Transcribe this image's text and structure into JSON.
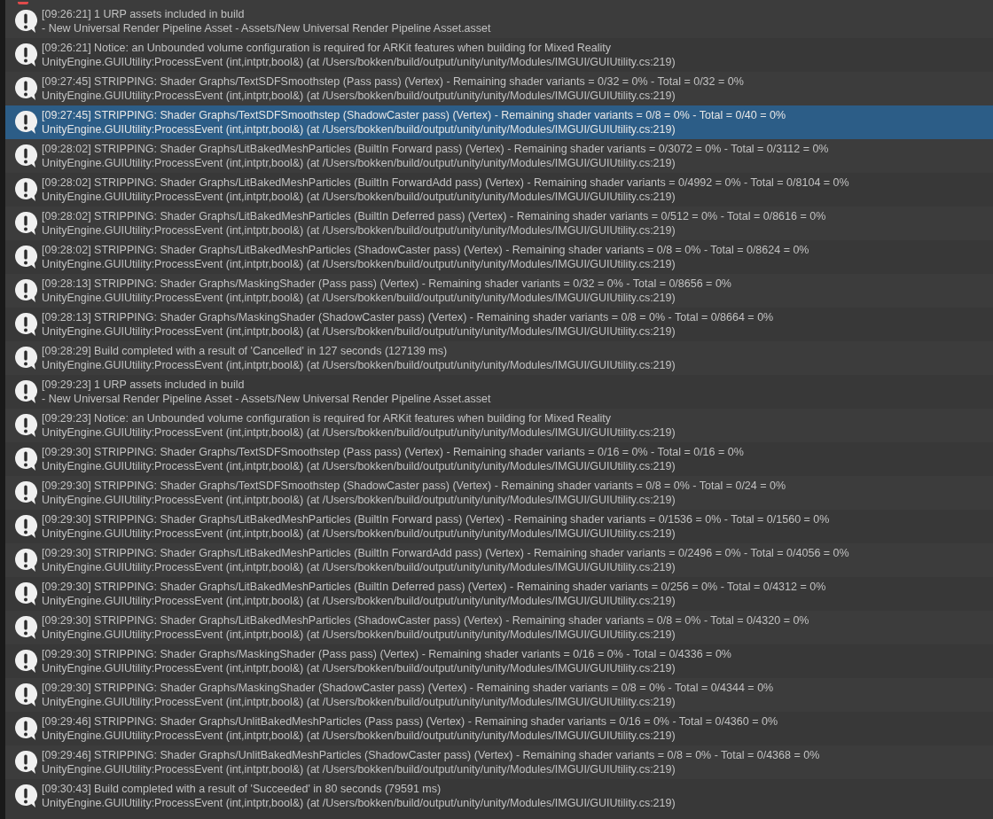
{
  "entries": [
    {
      "kind": "info",
      "selected": false,
      "message": "[09:26:21] 1 URP assets included in build",
      "detail": "- New Universal Render Pipeline Asset - Assets/New Universal Render Pipeline Asset.asset"
    },
    {
      "kind": "info",
      "selected": false,
      "message": "[09:26:21] Notice: an Unbounded volume configuration is required for ARKit features when building for Mixed Reality",
      "detail": "UnityEngine.GUIUtility:ProcessEvent (int,intptr,bool&) (at /Users/bokken/build/output/unity/unity/Modules/IMGUI/GUIUtility.cs:219)"
    },
    {
      "kind": "info",
      "selected": false,
      "message": "[09:27:45] STRIPPING: Shader Graphs/TextSDFSmoothstep (Pass pass) (Vertex) - Remaining shader variants = 0/32 = 0% - Total = 0/32 = 0%",
      "detail": "UnityEngine.GUIUtility:ProcessEvent (int,intptr,bool&) (at /Users/bokken/build/output/unity/unity/Modules/IMGUI/GUIUtility.cs:219)"
    },
    {
      "kind": "info",
      "selected": true,
      "message": "[09:27:45] STRIPPING: Shader Graphs/TextSDFSmoothstep (ShadowCaster pass) (Vertex) - Remaining shader variants = 0/8 = 0% - Total = 0/40 = 0%",
      "detail": "UnityEngine.GUIUtility:ProcessEvent (int,intptr,bool&) (at /Users/bokken/build/output/unity/unity/Modules/IMGUI/GUIUtility.cs:219)"
    },
    {
      "kind": "info",
      "selected": false,
      "message": "[09:28:02] STRIPPING: Shader Graphs/LitBakedMeshParticles (BuiltIn Forward pass) (Vertex) - Remaining shader variants = 0/3072 = 0% - Total = 0/3112 = 0%",
      "detail": "UnityEngine.GUIUtility:ProcessEvent (int,intptr,bool&) (at /Users/bokken/build/output/unity/unity/Modules/IMGUI/GUIUtility.cs:219)"
    },
    {
      "kind": "info",
      "selected": false,
      "message": "[09:28:02] STRIPPING: Shader Graphs/LitBakedMeshParticles (BuiltIn ForwardAdd pass) (Vertex) - Remaining shader variants = 0/4992 = 0% - Total = 0/8104 = 0%",
      "detail": "UnityEngine.GUIUtility:ProcessEvent (int,intptr,bool&) (at /Users/bokken/build/output/unity/unity/Modules/IMGUI/GUIUtility.cs:219)"
    },
    {
      "kind": "info",
      "selected": false,
      "message": "[09:28:02] STRIPPING: Shader Graphs/LitBakedMeshParticles (BuiltIn Deferred pass) (Vertex) - Remaining shader variants = 0/512 = 0% - Total = 0/8616 = 0%",
      "detail": "UnityEngine.GUIUtility:ProcessEvent (int,intptr,bool&) (at /Users/bokken/build/output/unity/unity/Modules/IMGUI/GUIUtility.cs:219)"
    },
    {
      "kind": "info",
      "selected": false,
      "message": "[09:28:02] STRIPPING: Shader Graphs/LitBakedMeshParticles (ShadowCaster pass) (Vertex) - Remaining shader variants = 0/8 = 0% - Total = 0/8624 = 0%",
      "detail": "UnityEngine.GUIUtility:ProcessEvent (int,intptr,bool&) (at /Users/bokken/build/output/unity/unity/Modules/IMGUI/GUIUtility.cs:219)"
    },
    {
      "kind": "info",
      "selected": false,
      "message": "[09:28:13] STRIPPING: Shader Graphs/MaskingShader (Pass pass) (Vertex) - Remaining shader variants = 0/32 = 0% - Total = 0/8656 = 0%",
      "detail": "UnityEngine.GUIUtility:ProcessEvent (int,intptr,bool&) (at /Users/bokken/build/output/unity/unity/Modules/IMGUI/GUIUtility.cs:219)"
    },
    {
      "kind": "info",
      "selected": false,
      "message": "[09:28:13] STRIPPING: Shader Graphs/MaskingShader (ShadowCaster pass) (Vertex) - Remaining shader variants = 0/8 = 0% - Total = 0/8664 = 0%",
      "detail": "UnityEngine.GUIUtility:ProcessEvent (int,intptr,bool&) (at /Users/bokken/build/output/unity/unity/Modules/IMGUI/GUIUtility.cs:219)"
    },
    {
      "kind": "info",
      "selected": false,
      "message": "[09:28:29] Build completed with a result of 'Cancelled' in 127 seconds (127139 ms)",
      "detail": "UnityEngine.GUIUtility:ProcessEvent (int,intptr,bool&) (at /Users/bokken/build/output/unity/unity/Modules/IMGUI/GUIUtility.cs:219)"
    },
    {
      "kind": "info",
      "selected": false,
      "message": "[09:29:23] 1 URP assets included in build",
      "detail": "- New Universal Render Pipeline Asset - Assets/New Universal Render Pipeline Asset.asset"
    },
    {
      "kind": "info",
      "selected": false,
      "message": "[09:29:23] Notice: an Unbounded volume configuration is required for ARKit features when building for Mixed Reality",
      "detail": "UnityEngine.GUIUtility:ProcessEvent (int,intptr,bool&) (at /Users/bokken/build/output/unity/unity/Modules/IMGUI/GUIUtility.cs:219)"
    },
    {
      "kind": "info",
      "selected": false,
      "message": "[09:29:30] STRIPPING: Shader Graphs/TextSDFSmoothstep (Pass pass) (Vertex) - Remaining shader variants = 0/16 = 0% - Total = 0/16 = 0%",
      "detail": "UnityEngine.GUIUtility:ProcessEvent (int,intptr,bool&) (at /Users/bokken/build/output/unity/unity/Modules/IMGUI/GUIUtility.cs:219)"
    },
    {
      "kind": "info",
      "selected": false,
      "message": "[09:29:30] STRIPPING: Shader Graphs/TextSDFSmoothstep (ShadowCaster pass) (Vertex) - Remaining shader variants = 0/8 = 0% - Total = 0/24 = 0%",
      "detail": "UnityEngine.GUIUtility:ProcessEvent (int,intptr,bool&) (at /Users/bokken/build/output/unity/unity/Modules/IMGUI/GUIUtility.cs:219)"
    },
    {
      "kind": "info",
      "selected": false,
      "message": "[09:29:30] STRIPPING: Shader Graphs/LitBakedMeshParticles (BuiltIn Forward pass) (Vertex) - Remaining shader variants = 0/1536 = 0% - Total = 0/1560 = 0%",
      "detail": "UnityEngine.GUIUtility:ProcessEvent (int,intptr,bool&) (at /Users/bokken/build/output/unity/unity/Modules/IMGUI/GUIUtility.cs:219)"
    },
    {
      "kind": "info",
      "selected": false,
      "message": "[09:29:30] STRIPPING: Shader Graphs/LitBakedMeshParticles (BuiltIn ForwardAdd pass) (Vertex) - Remaining shader variants = 0/2496 = 0% - Total = 0/4056 = 0%",
      "detail": "UnityEngine.GUIUtility:ProcessEvent (int,intptr,bool&) (at /Users/bokken/build/output/unity/unity/Modules/IMGUI/GUIUtility.cs:219)"
    },
    {
      "kind": "info",
      "selected": false,
      "message": "[09:29:30] STRIPPING: Shader Graphs/LitBakedMeshParticles (BuiltIn Deferred pass) (Vertex) - Remaining shader variants = 0/256 = 0% - Total = 0/4312 = 0%",
      "detail": "UnityEngine.GUIUtility:ProcessEvent (int,intptr,bool&) (at /Users/bokken/build/output/unity/unity/Modules/IMGUI/GUIUtility.cs:219)"
    },
    {
      "kind": "info",
      "selected": false,
      "message": "[09:29:30] STRIPPING: Shader Graphs/LitBakedMeshParticles (ShadowCaster pass) (Vertex) - Remaining shader variants = 0/8 = 0% - Total = 0/4320 = 0%",
      "detail": "UnityEngine.GUIUtility:ProcessEvent (int,intptr,bool&) (at /Users/bokken/build/output/unity/unity/Modules/IMGUI/GUIUtility.cs:219)"
    },
    {
      "kind": "info",
      "selected": false,
      "message": "[09:29:30] STRIPPING: Shader Graphs/MaskingShader (Pass pass) (Vertex) - Remaining shader variants = 0/16 = 0% - Total = 0/4336 = 0%",
      "detail": "UnityEngine.GUIUtility:ProcessEvent (int,intptr,bool&) (at /Users/bokken/build/output/unity/unity/Modules/IMGUI/GUIUtility.cs:219)"
    },
    {
      "kind": "info",
      "selected": false,
      "message": "[09:29:30] STRIPPING: Shader Graphs/MaskingShader (ShadowCaster pass) (Vertex) - Remaining shader variants = 0/8 = 0% - Total = 0/4344 = 0%",
      "detail": "UnityEngine.GUIUtility:ProcessEvent (int,intptr,bool&) (at /Users/bokken/build/output/unity/unity/Modules/IMGUI/GUIUtility.cs:219)"
    },
    {
      "kind": "info",
      "selected": false,
      "message": "[09:29:46] STRIPPING: Shader Graphs/UnlitBakedMeshParticles (Pass pass) (Vertex) - Remaining shader variants = 0/16 = 0% - Total = 0/4360 = 0%",
      "detail": "UnityEngine.GUIUtility:ProcessEvent (int,intptr,bool&) (at /Users/bokken/build/output/unity/unity/Modules/IMGUI/GUIUtility.cs:219)"
    },
    {
      "kind": "info",
      "selected": false,
      "message": "[09:29:46] STRIPPING: Shader Graphs/UnlitBakedMeshParticles (ShadowCaster pass) (Vertex) - Remaining shader variants = 0/8 = 0% - Total = 0/4368 = 0%",
      "detail": "UnityEngine.GUIUtility:ProcessEvent (int,intptr,bool&) (at /Users/bokken/build/output/unity/unity/Modules/IMGUI/GUIUtility.cs:219)"
    },
    {
      "kind": "info",
      "selected": false,
      "message": "[09:30:43] Build completed with a result of 'Succeeded' in 80 seconds (79591 ms)",
      "detail": "UnityEngine.GUIUtility:ProcessEvent (int,intptr,bool&) (at /Users/bokken/build/output/unity/unity/Modules/IMGUI/GUIUtility.cs:219)"
    }
  ]
}
